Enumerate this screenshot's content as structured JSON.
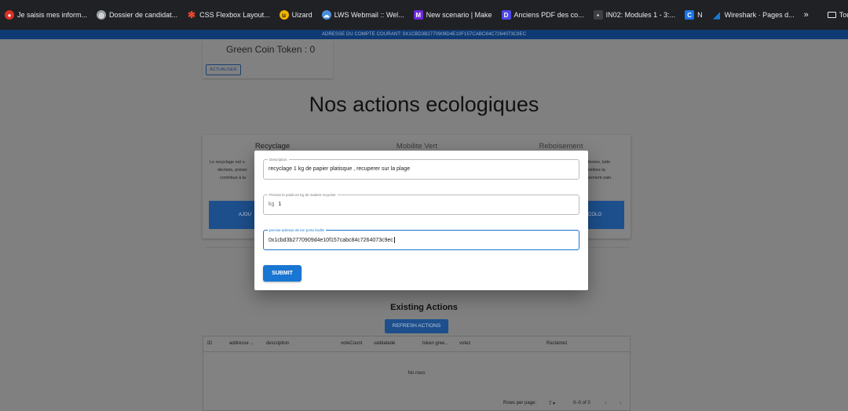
{
  "bookmarks": {
    "items": [
      {
        "label": "Je saisis mes inform...",
        "icon": "person-icon",
        "color": "#d93025"
      },
      {
        "label": "Dossier de candidat...",
        "icon": "globe-icon",
        "color": "#9aa0a6"
      },
      {
        "label": "CSS Flexbox Layout...",
        "icon": "asterisk-icon",
        "color": "#e8452c"
      },
      {
        "label": "Uizard",
        "icon": "uizard-icon",
        "color": "#f4b400"
      },
      {
        "label": "LWS Webmail :: Wel...",
        "icon": "cloud-icon",
        "color": "#4a90d9"
      },
      {
        "label": "New scenario | Make",
        "icon": "make-icon",
        "color": "#6d28d9"
      },
      {
        "label": "Anciens PDF des co...",
        "icon": "d-icon",
        "color": "#4f46e5"
      },
      {
        "label": "IN02: Modules 1 - 3:...",
        "icon": "dark-icon",
        "color": "#3c4043"
      },
      {
        "label": "N",
        "icon": "c-icon",
        "color": "#1a73e8"
      },
      {
        "label": "Wireshark · Pages d...",
        "icon": "shark-fin-icon",
        "color": "#1679d2"
      }
    ],
    "more": "»",
    "all_bookmarks": "Tous les favoris"
  },
  "account_bar": {
    "text": "ADRESSE DU COMPTE COURANT: 0X1CBD3B2770909D4E10F157CABC84C7264073C9EC"
  },
  "token": {
    "label": "Green Coin Token : 0",
    "refresh": "ACTUALISER"
  },
  "section": {
    "title": "Nos actions ecologiques"
  },
  "cards": [
    {
      "title": "Recyclage",
      "text": [
        "Le recyclage est u",
        "déchets, préser",
        "contribue à la"
      ],
      "button": "AJOU"
    },
    {
      "title": "Mobilite Vert",
      "text": [],
      "button": ""
    },
    {
      "title": "Reboisement",
      "text": [
        "rbones, lutte",
        "méliore la",
        "biement sain."
      ],
      "button": "COLO"
    }
  ],
  "existing": {
    "title": "Existing Actions",
    "refresh": "REFRESH ACTIONS",
    "columns": [
      "ID",
      "addresse ...",
      "description",
      "voteCount",
      "validatede",
      "token gree...",
      "votez",
      "Reclamez"
    ],
    "empty": "No rows",
    "rows_per_page_label": "Rows per page:",
    "rows_per_page": "7",
    "range": "0–0 of 0",
    "prev": "‹",
    "next": "›"
  },
  "modal": {
    "description": {
      "label": "Description",
      "value": "recyclage 1 kg de papier platisque , recuperer sur la plage"
    },
    "weight": {
      "label": "Precise le poids en kg de matiere recyclee",
      "prefix": "kg",
      "value": "1"
    },
    "wallet": {
      "label": "precise adresse de ton porte feuille",
      "value": "0x1cbd3b2770909d4e10f157cabc84c7264073c9ec"
    },
    "submit": "SUBMIT"
  },
  "colors": {
    "accent": "#1976d2",
    "banner": "#0f3a73",
    "overlay_bg": "#808080"
  }
}
